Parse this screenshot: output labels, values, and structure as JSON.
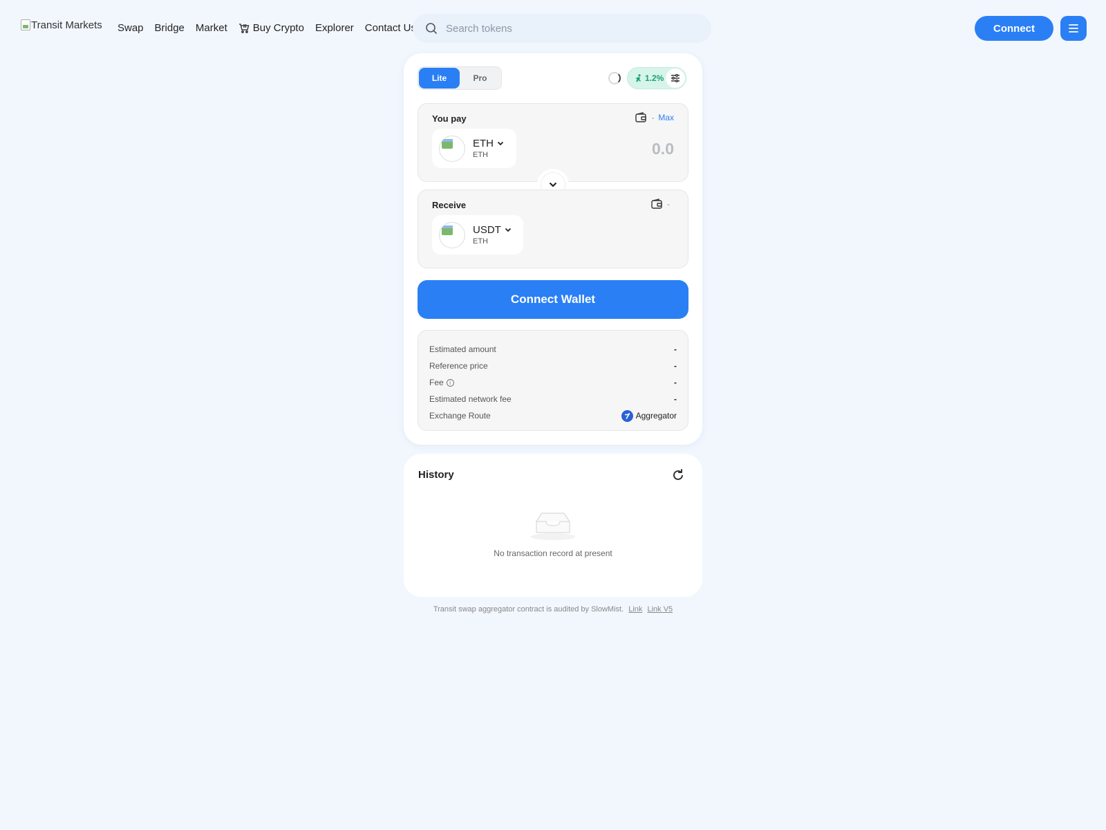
{
  "header": {
    "logo_alt": "Transit Markets",
    "nav": [
      "Swap",
      "Bridge",
      "Market",
      "Buy Crypto",
      "Explorer",
      "Contact Us"
    ],
    "search_placeholder": "Search tokens",
    "connect_label": "Connect"
  },
  "swap": {
    "modes": [
      "Lite",
      "Pro"
    ],
    "active_mode": "Lite",
    "slippage": "1.2%",
    "pay": {
      "label": "You pay",
      "balance": "-",
      "max_label": "Max",
      "token_symbol": "ETH",
      "token_chain": "ETH",
      "amount": "0.0"
    },
    "receive": {
      "label": "Receive",
      "balance": "-",
      "token_symbol": "USDT",
      "token_chain": "ETH"
    },
    "connect_wallet_label": "Connect Wallet",
    "details": [
      {
        "label": "Estimated amount",
        "value": "-"
      },
      {
        "label": "Reference price",
        "value": "-"
      },
      {
        "label": "Fee",
        "value": "-"
      },
      {
        "label": "Estimated network fee",
        "value": "-"
      }
    ],
    "route_label": "Exchange Route",
    "route_value": "Aggregator"
  },
  "history": {
    "title": "History",
    "empty_text": "No transaction record at present"
  },
  "footer": {
    "note": "Transit swap aggregator contract is audited by SlowMist.",
    "link1": "Link",
    "link2": "Link V5"
  },
  "colors": {
    "accent": "#2a7ff5",
    "background": "#f2f7fe",
    "slippage_bg": "#d7f4ea",
    "slippage_text": "#1aa370"
  }
}
